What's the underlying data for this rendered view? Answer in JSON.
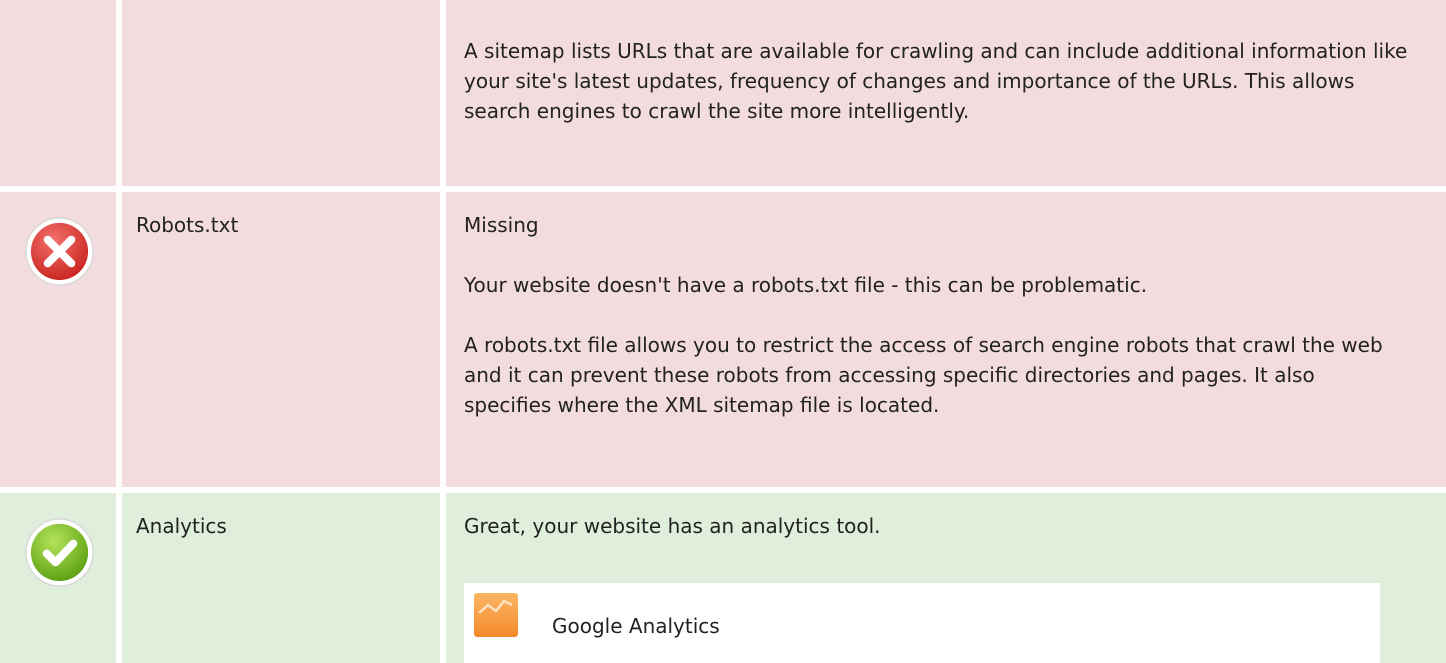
{
  "sitemap_row": {
    "description": "A sitemap lists URLs that are available for crawling and can include additional information like your site's latest updates, frequency of changes and importance of the URLs. This allows search engines to crawl the site more intelligently."
  },
  "robots_row": {
    "status_icon": "error-x-icon",
    "name": "Robots.txt",
    "status_text": "Missing",
    "message": "Your website doesn't have a robots.txt file - this can be problematic.",
    "description": "A robots.txt file allows you to restrict the access of search engine robots that crawl the web and it can prevent these robots from accessing specific directories and pages. It also specifies where the XML sitemap file is located."
  },
  "analytics_row": {
    "status_icon": "success-check-icon",
    "name": "Analytics",
    "message": "Great, your website has an analytics tool.",
    "tools": [
      {
        "icon": "google-analytics-logo-icon",
        "name": "Google Analytics"
      }
    ]
  },
  "colors": {
    "error_row_bg": "#f2dcdd",
    "success_row_bg": "#dfefdb",
    "error_icon": "#e23b36",
    "success_icon": "#7cc21b",
    "analytics_logo": "#f7953a"
  }
}
